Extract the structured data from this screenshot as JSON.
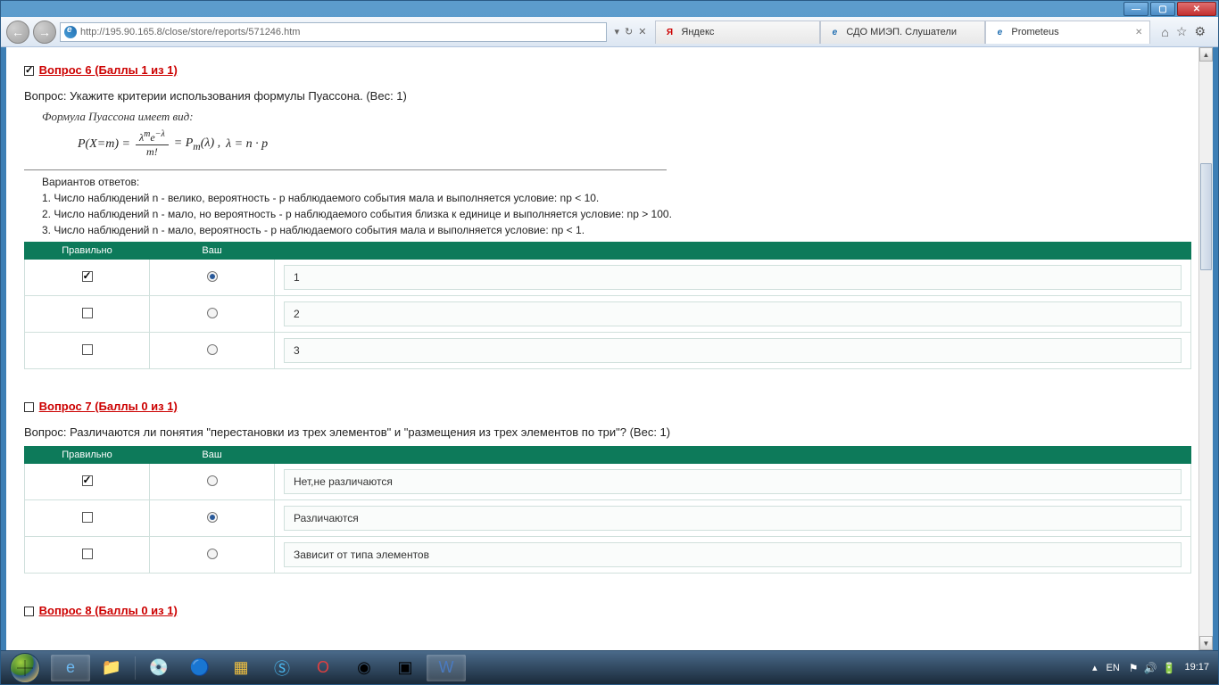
{
  "window": {
    "min": "—",
    "max": "▢",
    "close": "✕"
  },
  "toolbar": {
    "back": "←",
    "forward": "→",
    "url": "http://195.90.165.8/close/store/reports/571246.htm",
    "mini": [
      "▾",
      "↻",
      "✕"
    ]
  },
  "tabs": [
    {
      "icon": "Я",
      "label": "Яндекс",
      "iconColor": "#cc0000"
    },
    {
      "icon": "e",
      "label": "СДО МИЭП. Слушатели",
      "iconColor": "#1e6db0"
    },
    {
      "icon": "e",
      "label": "Prometeus",
      "iconColor": "#1e6db0",
      "closable": true
    }
  ],
  "rightIcons": [
    "⌂",
    "☆",
    "⚙"
  ],
  "q6": {
    "checked": true,
    "title": " Вопрос 6  (Баллы 1 из 1)",
    "text": "Вопрос: Укажите критерии использования формулы Пуассона. (Вес: 1)",
    "formula_intro": "Формула Пуассона имеет вид:",
    "formula": {
      "lhs": "P(X=m)  =",
      "num": "λ<sup>m</sup>e<sup>−λ</sup>",
      "den": "m!",
      "mid": "= P<sub>m</sub>(λ) ,",
      "rhs": "λ = n · p"
    },
    "variants_title": "Вариантов ответов:",
    "variants": [
      "1. Число наблюдений n - велико, вероятность - p наблюдаемого события мала и выполняется условие: np < 10.",
      "2. Число наблюдений n - мало, но вероятность - p наблюдаемого события близка к единице и выполняется условие: np > 100.",
      "3. Число наблюдений n - мало, вероятность - p наблюдаемого события  мала и выполняется условие: np < 1."
    ],
    "headers": {
      "correct": "Правильно",
      "your": "Ваш"
    },
    "rows": [
      {
        "correct": true,
        "your": true,
        "answer": "1"
      },
      {
        "correct": false,
        "your": false,
        "answer": "2"
      },
      {
        "correct": false,
        "your": false,
        "answer": "3"
      }
    ]
  },
  "q7": {
    "checked": false,
    "title": " Вопрос 7  (Баллы 0 из 1)",
    "text": "Вопрос: Различаются ли понятия \"перестановки из трех элементов\" и \"размещения из трех элементов по три\"? (Вес: 1)",
    "headers": {
      "correct": "Правильно",
      "your": "Ваш"
    },
    "rows": [
      {
        "correct": true,
        "your": false,
        "answer": "Нет,не различаются"
      },
      {
        "correct": false,
        "your": true,
        "answer": "Различаются"
      },
      {
        "correct": false,
        "your": false,
        "answer": "Зависит от типа элементов"
      }
    ]
  },
  "q8": {
    "checked": false,
    "title": " Вопрос 8  (Баллы 0 из 1)"
  },
  "tray": {
    "arrow": "▴",
    "lang": "EN",
    "icons": [
      "⚑",
      "🔊",
      "🔋"
    ],
    "time": "19:17"
  }
}
